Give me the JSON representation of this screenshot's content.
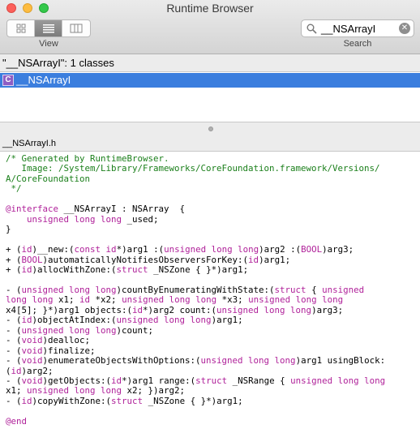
{
  "window": {
    "title": "Runtime Browser"
  },
  "toolbar": {
    "view_label": "View",
    "view_modes": [
      "grid-icon",
      "list-icon",
      "columns-icon"
    ],
    "search_label": "Search",
    "search_value": "__NSArrayI"
  },
  "class_list": {
    "header": "\"__NSArrayI\": 1 classes",
    "items": [
      {
        "badge": "C",
        "name": "__NSArrayI",
        "selected": true
      }
    ]
  },
  "file": {
    "name": "__NSArrayI.h"
  },
  "code": {
    "lines": [
      [
        [
          "cm",
          "/* Generated by RuntimeBrowser."
        ]
      ],
      [
        [
          "cm",
          "   Image: /System/Library/Frameworks/CoreFoundation.framework/Versions/"
        ]
      ],
      [
        [
          "cm",
          "A/CoreFoundation"
        ]
      ],
      [
        [
          "cm",
          " */"
        ]
      ],
      [
        [
          "",
          ""
        ]
      ],
      [
        [
          "kw",
          "@interface"
        ],
        [
          "",
          " __NSArrayI : NSArray  {"
        ]
      ],
      [
        [
          "",
          "    "
        ],
        [
          "kw",
          "unsigned long long"
        ],
        [
          "",
          " _used;"
        ]
      ],
      [
        [
          "",
          "}"
        ]
      ],
      [
        [
          "",
          ""
        ]
      ],
      [
        [
          "",
          "+ ("
        ],
        [
          "kw",
          "id"
        ],
        [
          "",
          ")__new:("
        ],
        [
          "kw",
          "const id"
        ],
        [
          "",
          "*)arg1 :("
        ],
        [
          "kw",
          "unsigned long long"
        ],
        [
          "",
          ")arg2 :("
        ],
        [
          "kw",
          "BOOL"
        ],
        [
          "",
          ")arg3;"
        ]
      ],
      [
        [
          "",
          "+ ("
        ],
        [
          "kw",
          "BOOL"
        ],
        [
          "",
          ")automaticallyNotifiesObserversForKey:("
        ],
        [
          "kw",
          "id"
        ],
        [
          "",
          ")arg1;"
        ]
      ],
      [
        [
          "",
          "+ ("
        ],
        [
          "kw",
          "id"
        ],
        [
          "",
          ")allocWithZone:("
        ],
        [
          "kw",
          "struct"
        ],
        [
          "",
          " _NSZone { }*)arg1;"
        ]
      ],
      [
        [
          "",
          ""
        ]
      ],
      [
        [
          "",
          "- ("
        ],
        [
          "kw",
          "unsigned long long"
        ],
        [
          "",
          ")countByEnumeratingWithState:("
        ],
        [
          "kw",
          "struct"
        ],
        [
          "",
          " { "
        ],
        [
          "kw",
          "unsigned"
        ]
      ],
      [
        [
          "kw",
          "long long"
        ],
        [
          "",
          " x1; "
        ],
        [
          "kw",
          "id"
        ],
        [
          "",
          " *x2; "
        ],
        [
          "kw",
          "unsigned long long"
        ],
        [
          "",
          " *x3; "
        ],
        [
          "kw",
          "unsigned long long"
        ]
      ],
      [
        [
          "",
          "x4[5]; }*)arg1 objects:("
        ],
        [
          "kw",
          "id"
        ],
        [
          "",
          "*)arg2 count:("
        ],
        [
          "kw",
          "unsigned long long"
        ],
        [
          "",
          ")arg3;"
        ]
      ],
      [
        [
          "",
          "- ("
        ],
        [
          "kw",
          "id"
        ],
        [
          "",
          ")objectAtIndex:("
        ],
        [
          "kw",
          "unsigned long long"
        ],
        [
          "",
          ")arg1;"
        ]
      ],
      [
        [
          "",
          "- ("
        ],
        [
          "kw",
          "unsigned long long"
        ],
        [
          "",
          ")count;"
        ]
      ],
      [
        [
          "",
          "- ("
        ],
        [
          "kw",
          "void"
        ],
        [
          "",
          ")dealloc;"
        ]
      ],
      [
        [
          "",
          "- ("
        ],
        [
          "kw",
          "void"
        ],
        [
          "",
          ")finalize;"
        ]
      ],
      [
        [
          "",
          "- ("
        ],
        [
          "kw",
          "void"
        ],
        [
          "",
          ")enumerateObjectsWithOptions:("
        ],
        [
          "kw",
          "unsigned long long"
        ],
        [
          "",
          ")arg1 usingBlock:"
        ]
      ],
      [
        [
          "",
          "("
        ],
        [
          "kw",
          "id"
        ],
        [
          "",
          ")arg2;"
        ]
      ],
      [
        [
          "",
          "- ("
        ],
        [
          "kw",
          "void"
        ],
        [
          "",
          ")getObjects:("
        ],
        [
          "kw",
          "id"
        ],
        [
          "",
          "*)arg1 range:("
        ],
        [
          "kw",
          "struct"
        ],
        [
          "",
          " _NSRange { "
        ],
        [
          "kw",
          "unsigned long long"
        ]
      ],
      [
        [
          "",
          "x1; "
        ],
        [
          "kw",
          "unsigned long long"
        ],
        [
          "",
          " x2; })arg2;"
        ]
      ],
      [
        [
          "",
          "- ("
        ],
        [
          "kw",
          "id"
        ],
        [
          "",
          ")copyWithZone:("
        ],
        [
          "kw",
          "struct"
        ],
        [
          "",
          " _NSZone { }*)arg1;"
        ]
      ],
      [
        [
          "",
          ""
        ]
      ],
      [
        [
          "kw",
          "@end"
        ]
      ]
    ]
  }
}
